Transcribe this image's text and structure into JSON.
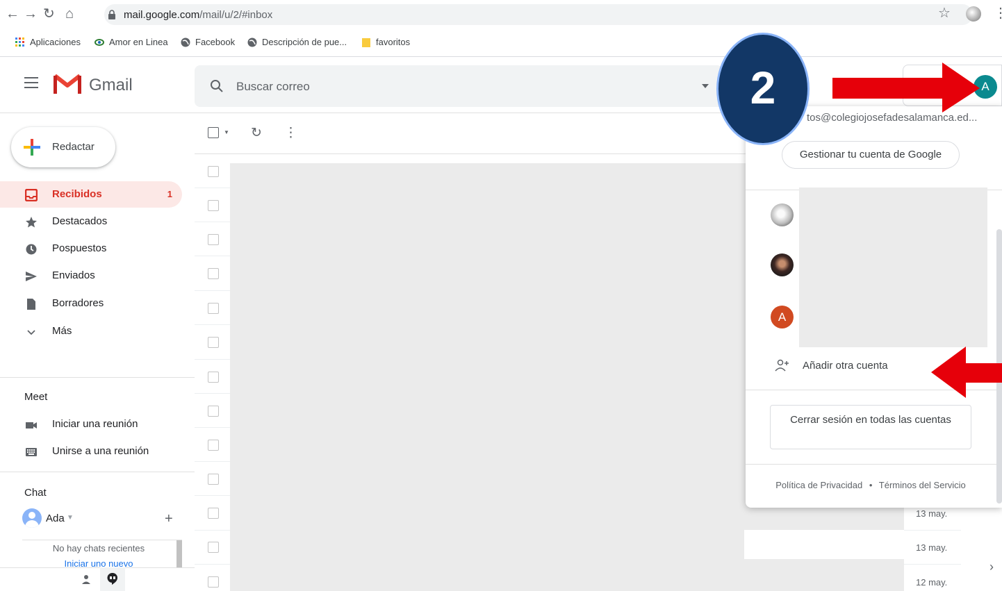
{
  "browser": {
    "url_host": "mail.google.com",
    "url_path": "/mail/u/2/#inbox",
    "bookmarks": [
      "Aplicaciones",
      "Amor en Linea",
      "Facebook",
      "Descripción de pue...",
      "favoritos"
    ]
  },
  "header": {
    "app_name": "Gmail",
    "search_placeholder": "Buscar correo"
  },
  "sidebar": {
    "compose_label": "Redactar",
    "items": [
      {
        "label": "Recibidos",
        "count": "1"
      },
      {
        "label": "Destacados"
      },
      {
        "label": "Pospuestos"
      },
      {
        "label": "Enviados"
      },
      {
        "label": "Borradores"
      },
      {
        "label": "Más"
      }
    ],
    "meet_title": "Meet",
    "meet_items": [
      "Iniciar una reunión",
      "Unirse a una reunión"
    ],
    "chat_title": "Chat",
    "chat_user": "Ada",
    "chat_empty": "No hay chats recientes",
    "chat_start": "Iniciar uno nuevo"
  },
  "list": {
    "dates": [
      "13 may.",
      "13 may.",
      "12 may."
    ]
  },
  "account_popup": {
    "avatar_letter": "A",
    "email": "tos@colegiojosefadesalamanca.ed...",
    "manage_label": "Gestionar tu cuenta de Google",
    "third_avatar_letter": "A",
    "add_account_label": "Añadir otra cuenta",
    "signout_label": "Cerrar sesión en todas las cuentas",
    "privacy_label": "Política de Privacidad",
    "separator": "•",
    "terms_label": "Términos del Servicio"
  },
  "annotation": {
    "step_number": "2",
    "arrow_color": "#e6000a",
    "circle_color": "#123766"
  }
}
